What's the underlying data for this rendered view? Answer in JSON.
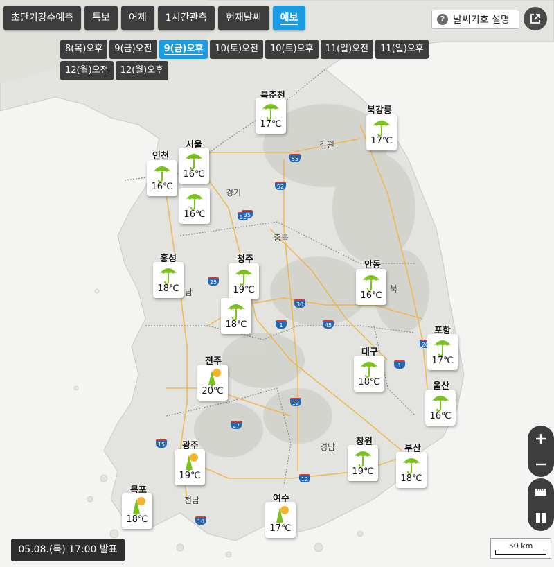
{
  "tabs": [
    {
      "label": "초단기강수예측",
      "active": false
    },
    {
      "label": "특보",
      "active": false
    },
    {
      "label": "어제",
      "active": false
    },
    {
      "label": "1시간관측",
      "active": false
    },
    {
      "label": "현재날씨",
      "active": false
    },
    {
      "label": "예보",
      "active": true
    }
  ],
  "times": [
    {
      "label": "8(목)오후",
      "active": false
    },
    {
      "label": "9(금)오전",
      "active": false
    },
    {
      "label": "9(금)오후",
      "active": true
    },
    {
      "label": "10(토)오전",
      "active": false
    },
    {
      "label": "10(토)오후",
      "active": false
    },
    {
      "label": "11(일)오전",
      "active": false
    },
    {
      "label": "11(일)오후",
      "active": false
    },
    {
      "label": "12(월)오전",
      "active": false
    },
    {
      "label": "12(월)오후",
      "active": false
    }
  ],
  "legend_button": "날씨기호 설명",
  "legend_icon": "?",
  "issued": "05.08.(목) 17:00 발표",
  "scale": "50 km",
  "regions": [
    "강원",
    "경기",
    "충북",
    "남",
    "경남",
    "전남",
    "북"
  ],
  "roads": [
    "55",
    "52",
    "35",
    "25",
    "30",
    "1",
    "45",
    "20",
    "12",
    "27",
    "15",
    "10"
  ],
  "weather": [
    {
      "city": "북춘천",
      "temp": "17℃",
      "icon": "rain-umbrella-icon"
    },
    {
      "city": "북강릉",
      "temp": "17℃",
      "icon": "rain-umbrella-icon"
    },
    {
      "city": "인천",
      "temp": "16℃",
      "icon": "rain-umbrella-icon"
    },
    {
      "city": "서울",
      "temp": "16℃",
      "icon": "rain-umbrella-icon"
    },
    {
      "city": "",
      "temp": "16℃",
      "icon": "rain-umbrella-icon"
    },
    {
      "city": "홍성",
      "temp": "18℃",
      "icon": "rain-umbrella-icon"
    },
    {
      "city": "청주",
      "temp": "19℃",
      "icon": "rain-umbrella-icon"
    },
    {
      "city": "",
      "temp": "18℃",
      "icon": "rain-umbrella-icon"
    },
    {
      "city": "안동",
      "temp": "16℃",
      "icon": "rain-umbrella-icon"
    },
    {
      "city": "포항",
      "temp": "17℃",
      "icon": "rain-umbrella-icon"
    },
    {
      "city": "대구",
      "temp": "18℃",
      "icon": "rain-umbrella-icon"
    },
    {
      "city": "전주",
      "temp": "20℃",
      "icon": "rain-sun-icon"
    },
    {
      "city": "울산",
      "temp": "16℃",
      "icon": "rain-umbrella-icon"
    },
    {
      "city": "광주",
      "temp": "19℃",
      "icon": "rain-sun-icon"
    },
    {
      "city": "창원",
      "temp": "19℃",
      "icon": "rain-umbrella-icon"
    },
    {
      "city": "부산",
      "temp": "18℃",
      "icon": "rain-umbrella-icon"
    },
    {
      "city": "목포",
      "temp": "18℃",
      "icon": "rain-sun-icon"
    },
    {
      "city": "여수",
      "temp": "17℃",
      "icon": "rain-sun-icon"
    }
  ],
  "colors": {
    "active": "#1d9be0",
    "dark": "#3d3d3d",
    "umbrella": "#7cc21f",
    "sun": "#f7b32b",
    "land": "#e3e3df",
    "sea": "#ffffff"
  }
}
